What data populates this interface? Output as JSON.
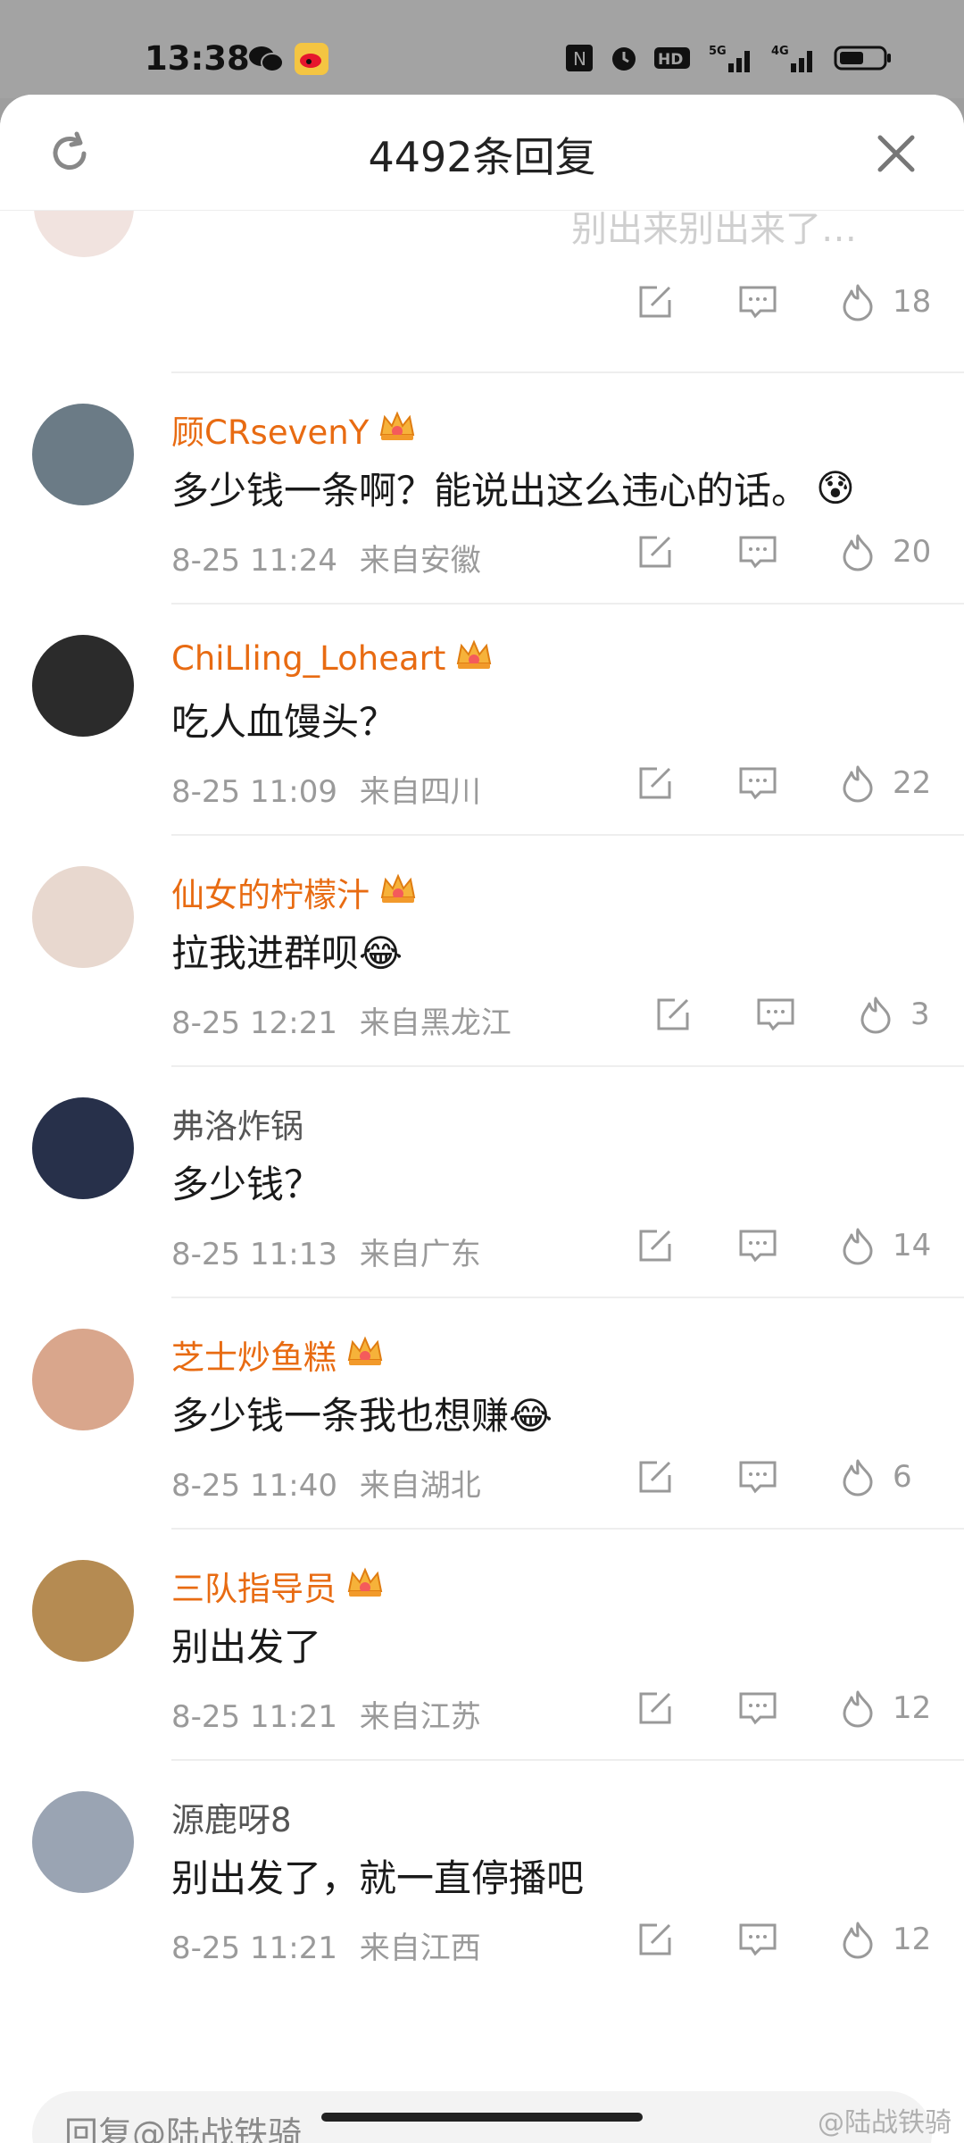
{
  "status_bar": {
    "time": "13:38"
  },
  "header": {
    "title": "4492条回复"
  },
  "partial_comment": {
    "text_fragment": "别出来别出来了…",
    "likes": "18"
  },
  "comments": [
    {
      "name": "顾CRsevenY",
      "vip": true,
      "text": "多少钱一条啊？能说出这么违心的话。",
      "time": "8-25 11:24",
      "location": "来自安徽",
      "likes": "20",
      "avatar_color": "#6b7b86",
      "emoji": "😰"
    },
    {
      "name": "ChiLling_Loheart",
      "vip": true,
      "text": "吃人血馒头？",
      "time": "8-25 11:09",
      "location": "来自四川",
      "likes": "22",
      "avatar_color": "#2b2b2b",
      "emoji": ""
    },
    {
      "name": "仙女的柠檬汁",
      "vip": true,
      "text": "拉我进群呗😂",
      "time": "8-25 12:21",
      "location": "来自黑龙江",
      "likes": "3",
      "avatar_color": "#e8d8cf",
      "emoji": ""
    },
    {
      "name": "弗洛炸锅",
      "vip": false,
      "text": "多少钱？",
      "time": "8-25 11:13",
      "location": "来自广东",
      "likes": "14",
      "avatar_color": "#27304a",
      "emoji": ""
    },
    {
      "name": "芝士炒鱼糕",
      "vip": true,
      "text": "多少钱一条我也想赚😂",
      "time": "8-25 11:40",
      "location": "来自湖北",
      "likes": "6",
      "avatar_color": "#d9a68c",
      "emoji": ""
    },
    {
      "name": "三队指导员",
      "vip": true,
      "text": "别出发了",
      "time": "8-25 11:21",
      "location": "来自江苏",
      "likes": "12",
      "avatar_color": "#b58b52",
      "emoji": ""
    },
    {
      "name": "源鹿呀8",
      "vip": false,
      "text": "别出发了，就一直停播吧",
      "time": "8-25 11:21",
      "location": "来自江西",
      "likes": "12",
      "avatar_color": "#9aa4b3",
      "emoji": ""
    }
  ],
  "reply": {
    "placeholder": "回复@陆战铁骑"
  },
  "watermark": "@陆战铁骑",
  "colors": {
    "username": "#e86b12",
    "meta": "#9a9a9a"
  }
}
